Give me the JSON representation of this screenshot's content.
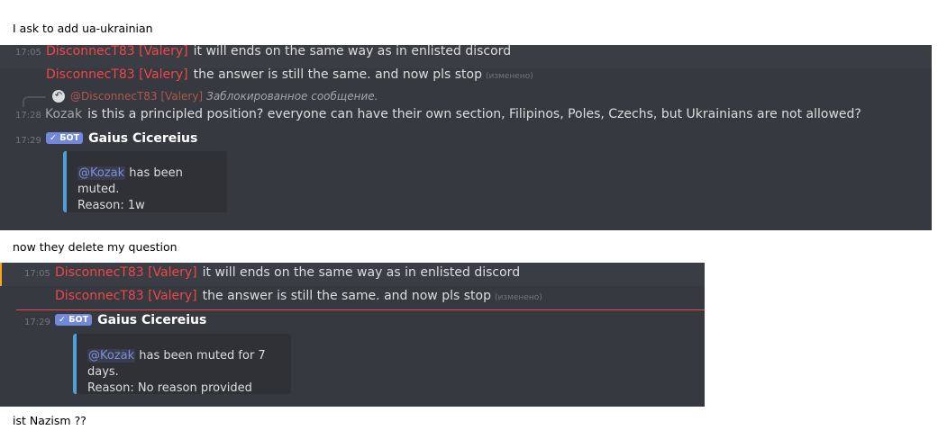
{
  "notes": {
    "top": "I ask to add ua-ukrainian",
    "middle": "now they delete my question",
    "bottom": "ist Nazism ??"
  },
  "panel1": {
    "messages": [
      {
        "time": "17:05",
        "author": "DisconnecT83 [Valery]",
        "text": "it will ends on the same way as in enlisted discord"
      },
      {
        "author": "DisconnecT83 [Valery]",
        "text": "the answer is still the same. and now pls stop",
        "edited": "(изменено)"
      }
    ],
    "reply": {
      "icon": "reply-arrow-icon",
      "name": "@DisconnecT83 [Valery]",
      "text": "Заблокированное сообщение."
    },
    "kozak_message": {
      "time": "17:28",
      "author": "Kozak",
      "text": "is this a principled position? everyone can have their own section, Filipinos, Poles, Czechs, but Ukrainians are not allowed?"
    },
    "bot_message": {
      "time": "17:29",
      "bot_tag": "✓ БОТ",
      "author": "Gaius Cicereius",
      "embed_mention": "@Kozak",
      "embed_line1": "has been muted.",
      "embed_line2": "Reason: 1w"
    }
  },
  "panel2": {
    "messages": [
      {
        "time": "17:05",
        "author": "DisconnecT83 [Valery]",
        "text": "it will ends on the same way as in enlisted discord"
      },
      {
        "author": "DisconnecT83 [Valery]",
        "text": "the answer is still the same. and now pls stop",
        "edited": "(изменено)"
      }
    ],
    "bot_message": {
      "time": "17:29",
      "bot_tag": "✓ БОТ",
      "author": "Gaius Cicereius",
      "embed_mention": "@Kozak",
      "embed_line1": "has been muted for 7 days.",
      "embed_line2": "Reason: No reason provided"
    }
  },
  "colors": {
    "background": "#36393f",
    "author_red": "#f04747",
    "bot_tag": "#7289da",
    "embed_border": "#4f9fd8",
    "edit_marker": "#faa61a"
  }
}
